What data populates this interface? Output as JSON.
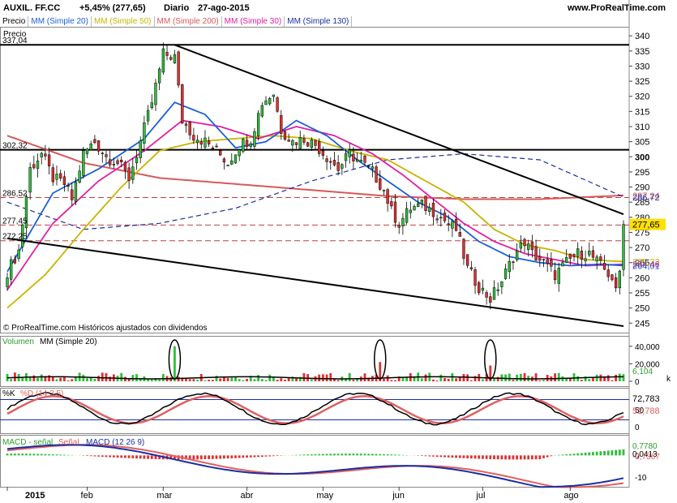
{
  "header": {
    "ticker": "AUXIL. FF.CC",
    "change": "+5,45% (277,65)",
    "period": "Diario",
    "date": "27-ago-2015",
    "site": "www.ProRealTime.com"
  },
  "legend": [
    {
      "label": "Precio",
      "color": "#000000"
    },
    {
      "label": "MM (Simple 20)",
      "color": "#1a5fd6"
    },
    {
      "label": "MM (Simple 50)",
      "color": "#c8b400"
    },
    {
      "label": "MM (Simple 200)",
      "color": "#d65a5a"
    },
    {
      "label": "MM (Simple 30)",
      "color": "#e020a0"
    },
    {
      "label": "MM (Simple 130)",
      "color": "#1a2fa0"
    }
  ],
  "price_labels": [
    {
      "text": "337,04",
      "value": 337.04
    },
    {
      "text": "302,32",
      "value": 302.32
    },
    {
      "text": "286,52",
      "value": 286.52
    },
    {
      "text": "277,45",
      "value": 277.45
    },
    {
      "text": "272,25",
      "value": 272.25
    }
  ],
  "right_tags": [
    {
      "text": "287,24",
      "value": 287.24,
      "color": "#d65a5a"
    },
    {
      "text": "286,72",
      "value": 286.72,
      "color": "#1a2fa0"
    },
    {
      "text": "277,65",
      "value": 277.65,
      "color": "#000000",
      "bg": "#ffe000"
    },
    {
      "text": "265,33",
      "value": 265.33,
      "color": "#c8b400"
    },
    {
      "text": "264,46",
      "value": 264.46,
      "color": "#e020a0"
    },
    {
      "text": "264,01",
      "value": 264.01,
      "color": "#1a5fd6"
    }
  ],
  "copyright": "© ProRealTime.com  Históricos ajustados con dividendos",
  "volume": {
    "title": "Volumen",
    "ma_label": "MM (Simple 20)",
    "value_tag": "6,104",
    "unit_tag": "k"
  },
  "stoch": {
    "title": "%K",
    "title2": "%D (14 3 5)",
    "k_tag": "72,783",
    "d_tag": "52,788"
  },
  "macd": {
    "title": "MACD - señal",
    "signal": "Señal",
    "macd_label": "MACD (12 26 9)",
    "tag1": "0,7780",
    "tag2": "-0,7367",
    "tag3": "0,0413"
  },
  "months": [
    "2015",
    "feb",
    "mar",
    "abr",
    "may",
    "jun",
    "jul",
    "ago"
  ],
  "chart_data": {
    "type": "candlestick",
    "title": "AUXIL. FF.CC",
    "period": "Diario",
    "y_range": [
      244,
      343
    ],
    "y_ticks": [
      245,
      250,
      255,
      260,
      265,
      270,
      275,
      280,
      285,
      290,
      295,
      300,
      305,
      310,
      315,
      320,
      325,
      330,
      335,
      340
    ],
    "months": [
      {
        "label": "2015",
        "start_index": 0
      },
      {
        "label": "feb",
        "start_index": 21
      },
      {
        "label": "mar",
        "start_index": 41
      },
      {
        "label": "abr",
        "start_index": 63
      },
      {
        "label": "may",
        "start_index": 83
      },
      {
        "label": "jun",
        "start_index": 103
      },
      {
        "label": "jul",
        "start_index": 125
      },
      {
        "label": "ago",
        "start_index": 148
      }
    ],
    "close_anchors": [
      [
        0,
        262
      ],
      [
        3,
        269
      ],
      [
        6,
        296
      ],
      [
        9,
        301
      ],
      [
        12,
        293
      ],
      [
        15,
        291
      ],
      [
        17,
        286
      ],
      [
        20,
        301
      ],
      [
        23,
        305
      ],
      [
        26,
        300
      ],
      [
        29,
        298
      ],
      [
        32,
        293
      ],
      [
        35,
        305
      ],
      [
        38,
        318
      ],
      [
        41,
        334
      ],
      [
        44,
        333
      ],
      [
        46,
        312
      ],
      [
        49,
        307
      ],
      [
        52,
        305
      ],
      [
        55,
        302
      ],
      [
        58,
        298
      ],
      [
        61,
        304
      ],
      [
        64,
        306
      ],
      [
        67,
        318
      ],
      [
        70,
        321
      ],
      [
        72,
        309
      ],
      [
        75,
        305
      ],
      [
        78,
        306
      ],
      [
        81,
        304
      ],
      [
        84,
        300
      ],
      [
        87,
        296
      ],
      [
        90,
        301
      ],
      [
        93,
        298
      ],
      [
        96,
        295
      ],
      [
        99,
        289
      ],
      [
        101,
        282
      ],
      [
        103,
        278
      ],
      [
        106,
        283
      ],
      [
        109,
        284
      ],
      [
        112,
        282
      ],
      [
        115,
        279
      ],
      [
        118,
        276
      ],
      [
        121,
        263
      ],
      [
        124,
        257
      ],
      [
        127,
        253
      ],
      [
        130,
        259
      ],
      [
        133,
        267
      ],
      [
        136,
        272
      ],
      [
        138,
        268
      ],
      [
        141,
        265
      ],
      [
        144,
        261
      ],
      [
        147,
        265
      ],
      [
        150,
        268
      ],
      [
        153,
        268
      ],
      [
        156,
        264
      ],
      [
        159,
        260
      ],
      [
        160,
        255
      ],
      [
        161,
        262
      ],
      [
        162,
        277.65
      ]
    ],
    "ma20_anchors": [
      [
        0,
        262
      ],
      [
        12,
        288
      ],
      [
        24,
        296
      ],
      [
        36,
        306
      ],
      [
        44,
        318
      ],
      [
        52,
        314
      ],
      [
        60,
        303
      ],
      [
        68,
        305
      ],
      [
        76,
        312
      ],
      [
        84,
        307
      ],
      [
        92,
        299
      ],
      [
        100,
        292
      ],
      [
        108,
        285
      ],
      [
        116,
        280
      ],
      [
        124,
        272
      ],
      [
        132,
        267
      ],
      [
        140,
        265
      ],
      [
        148,
        264
      ],
      [
        156,
        264.5
      ],
      [
        162,
        264.01
      ]
    ],
    "ma50_anchors": [
      [
        0,
        250
      ],
      [
        10,
        261
      ],
      [
        20,
        276
      ],
      [
        30,
        290
      ],
      [
        40,
        302
      ],
      [
        50,
        305
      ],
      [
        60,
        306
      ],
      [
        70,
        307
      ],
      [
        80,
        306
      ],
      [
        90,
        302
      ],
      [
        100,
        299
      ],
      [
        110,
        292
      ],
      [
        120,
        285
      ],
      [
        128,
        276
      ],
      [
        136,
        271
      ],
      [
        144,
        269
      ],
      [
        152,
        266
      ],
      [
        162,
        265.33
      ]
    ],
    "ma30_anchors": [
      [
        0,
        256
      ],
      [
        12,
        278
      ],
      [
        24,
        292
      ],
      [
        36,
        302
      ],
      [
        46,
        312
      ],
      [
        56,
        310
      ],
      [
        66,
        306
      ],
      [
        76,
        310
      ],
      [
        86,
        307
      ],
      [
        96,
        301
      ],
      [
        104,
        294
      ],
      [
        112,
        286
      ],
      [
        120,
        278
      ],
      [
        128,
        272
      ],
      [
        136,
        268
      ],
      [
        144,
        266
      ],
      [
        152,
        264
      ],
      [
        162,
        264.46
      ]
    ],
    "ma200_anchors": [
      [
        0,
        307
      ],
      [
        20,
        298
      ],
      [
        40,
        293
      ],
      [
        60,
        291
      ],
      [
        80,
        289
      ],
      [
        100,
        287
      ],
      [
        120,
        286
      ],
      [
        140,
        286
      ],
      [
        162,
        287.24
      ]
    ],
    "ma130_anchors": [
      [
        0,
        285
      ],
      [
        20,
        276
      ],
      [
        40,
        278
      ],
      [
        60,
        283
      ],
      [
        80,
        292
      ],
      [
        100,
        299
      ],
      [
        120,
        301
      ],
      [
        140,
        299
      ],
      [
        162,
        286.72
      ]
    ],
    "horizontal_lines": [
      337.04,
      302.32
    ],
    "dashed_lines": [
      286.52,
      277.45,
      272.25
    ],
    "trendlines": [
      [
        [
          44,
          337
        ],
        [
          162,
          281
        ]
      ],
      [
        [
          0,
          273
        ],
        [
          162,
          244
        ]
      ]
    ],
    "volume_ylim": [
      0,
      50
    ],
    "volume_ticks": [
      0,
      20,
      40
    ],
    "stoch_ylim": [
      -10,
      110
    ],
    "stoch_ticks": [
      0,
      50
    ],
    "macd_ylim": [
      -13,
      8
    ],
    "macd_ticks": [
      -10,
      0
    ]
  }
}
